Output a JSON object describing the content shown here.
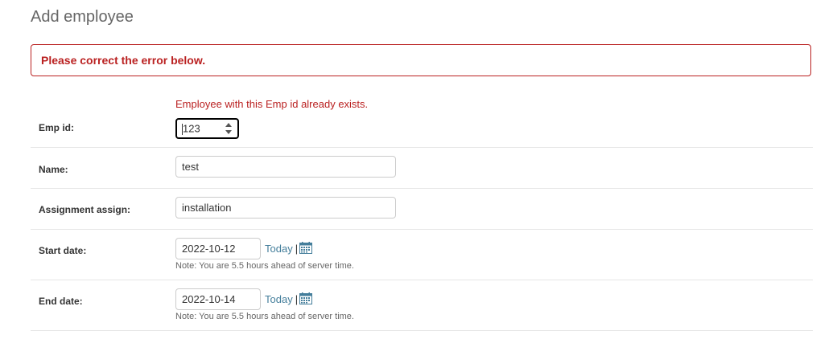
{
  "page": {
    "title": "Add employee"
  },
  "errornote": "Please correct the the error below.",
  "form": {
    "emp_id": {
      "label": "Emp id:",
      "error": "Employee with this Emp id already exists.",
      "value": "123"
    },
    "name": {
      "label": "Name:",
      "value": "test"
    },
    "assignment": {
      "label": "Assignment assign:",
      "value": "installation"
    },
    "start_date": {
      "label": "Start date:",
      "value": "2022-10-12",
      "today_label": "Today",
      "separator": "|",
      "help": "Note: You are 5.5 hours ahead of server time."
    },
    "end_date": {
      "label": "End date:",
      "value": "2022-10-14",
      "today_label": "Today",
      "separator": "|",
      "help": "Note: You are 5.5 hours ahead of server time."
    }
  },
  "icons": {
    "calendar": "calendar-icon",
    "spinner": "number-spinner-icon"
  },
  "colors": {
    "error": "#ba2121",
    "link": "#447e9b",
    "title": "#666666",
    "calendar": "#447e9b"
  }
}
